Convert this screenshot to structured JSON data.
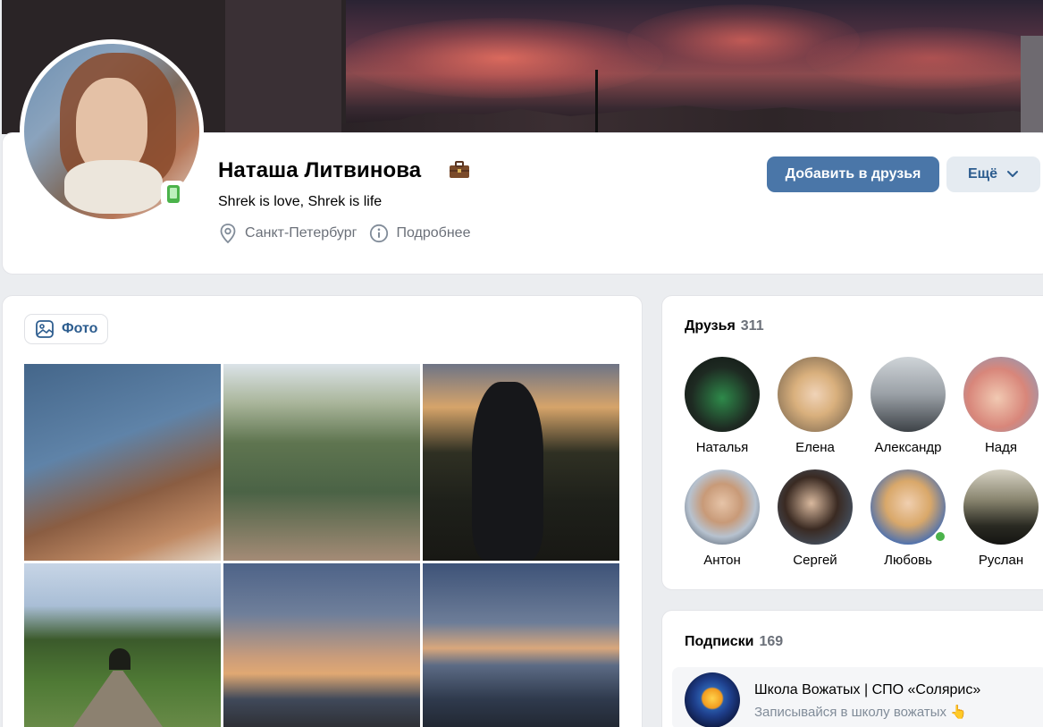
{
  "profile": {
    "name": "Наташа Литвинова",
    "status": "Shrek is love, Shrek is life",
    "city": "Санкт-Петербург",
    "details_link": "Подробнее",
    "add_friend_label": "Добавить в друзья",
    "more_label": "Ещё"
  },
  "photos": {
    "tab_label": "Фото"
  },
  "friends": {
    "title": "Друзья",
    "count": "311",
    "items": [
      {
        "name": "Наталья",
        "color": "#1e2a22"
      },
      {
        "name": "Елена",
        "color": "#c9a98a"
      },
      {
        "name": "Александр",
        "color": "#9aa0a6"
      },
      {
        "name": "Надя",
        "color": "#d8867a"
      },
      {
        "name": "Антон",
        "color": "#b7c2cf"
      },
      {
        "name": "Сергей",
        "color": "#3a4a3a"
      },
      {
        "name": "Любовь",
        "color": "#4a6fb0"
      },
      {
        "name": "Руслан",
        "color": "#5a5a48"
      }
    ]
  },
  "subscriptions": {
    "title": "Подписки",
    "count": "169",
    "items": [
      {
        "title": "Школа Вожатых | СПО «Солярис»",
        "desc": "Записывайся в школу вожатых 👆"
      }
    ]
  },
  "colors": {
    "accent": "#4a76a8",
    "online": "#4bb34b",
    "secondary_button_bg": "#e5ebf1"
  }
}
